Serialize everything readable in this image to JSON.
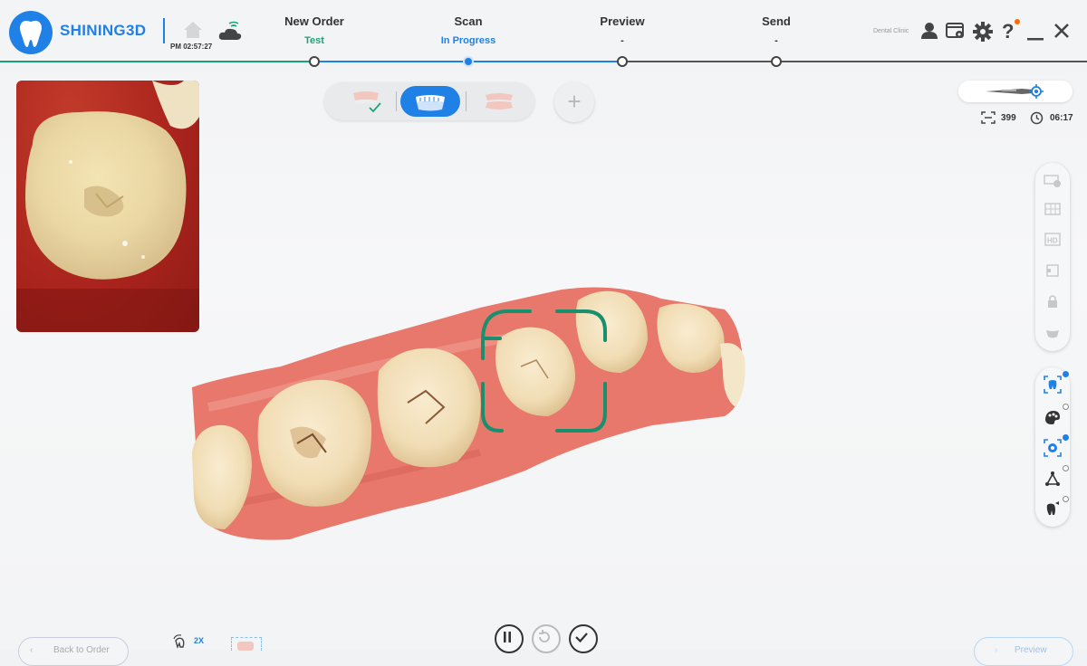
{
  "header": {
    "brand": "SHINING3D",
    "time": "PM 02:57:27",
    "clinic": "Dental Clinic",
    "steps": [
      {
        "label": "New Order",
        "sub": "Test",
        "sub_color": "#1aa37a"
      },
      {
        "label": "Scan",
        "sub": "In Progress",
        "sub_color": "#1f80e6"
      },
      {
        "label": "Preview",
        "sub": "-",
        "sub_color": "#333333"
      },
      {
        "label": "Send",
        "sub": "-",
        "sub_color": "#333333"
      }
    ],
    "icons": [
      "home-icon",
      "cloud-wifi-icon",
      "user-icon",
      "screen-settings-icon",
      "gear-icon",
      "help-icon",
      "minimize-icon",
      "close-icon"
    ]
  },
  "scan": {
    "frame_count": "399",
    "elapsed": "06:17"
  },
  "bottom": {
    "back_label": "Back to Order",
    "speed_label": "2X",
    "preview_label": "Preview"
  },
  "colors": {
    "accent": "#1f80e6",
    "scan_frame": "#1a8f6e",
    "progress_done": "#1aa37a",
    "gum": "#e8786b",
    "tooth": "#f3e2be"
  }
}
